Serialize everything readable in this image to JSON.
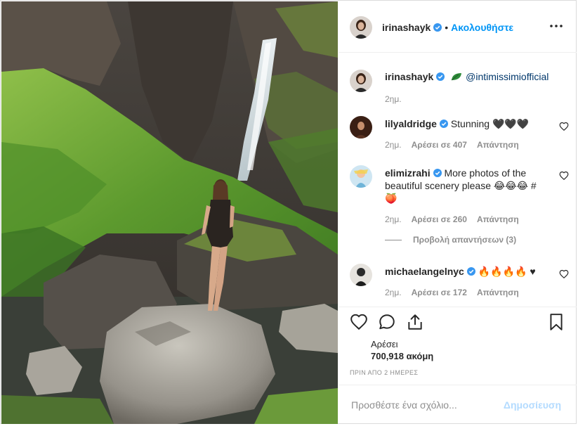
{
  "post": {
    "author": "irinashayk",
    "follow_label": "Ακολουθήστε",
    "dot": "•",
    "more_icon": "more-options-icon"
  },
  "caption": {
    "user": "irinashayk",
    "mention": "@intimissimiofficial",
    "time": "2ημ."
  },
  "comments": [
    {
      "user": "lilyaldridge",
      "text": "Stunning 🖤🖤🖤",
      "time": "2ημ.",
      "likes": "Αρέσει σε 407",
      "reply": "Απάντηση"
    },
    {
      "user": "elimizrahi",
      "text": "More photos of the beautiful scenery please 😂😂😂 #🍑",
      "time": "2ημ.",
      "likes": "Αρέσει σε 260",
      "reply": "Απάντηση",
      "view_replies": "Προβολή απαντήσεων (3)"
    },
    {
      "user": "michaelangelnyc",
      "text": "🔥🔥🔥🔥 ♥",
      "time": "2ημ.",
      "likes": "Αρέσει σε 172",
      "reply": "Απάντηση"
    }
  ],
  "actions": {
    "likes_label": "Αρέσει",
    "likes_count": "700,918 ακόμη",
    "date": "ΠΡΙΝ ΑΠΟ 2 ΗΜΕΡΕΣ"
  },
  "add_comment": {
    "placeholder": "Προσθέστε ένα σχόλιο...",
    "post_label": "Δημοσίευση"
  },
  "colors": {
    "accent": "#0095f6",
    "verified": "#3897f0",
    "muted": "#8e8e8e",
    "disabled_post": "#b3dbff"
  }
}
